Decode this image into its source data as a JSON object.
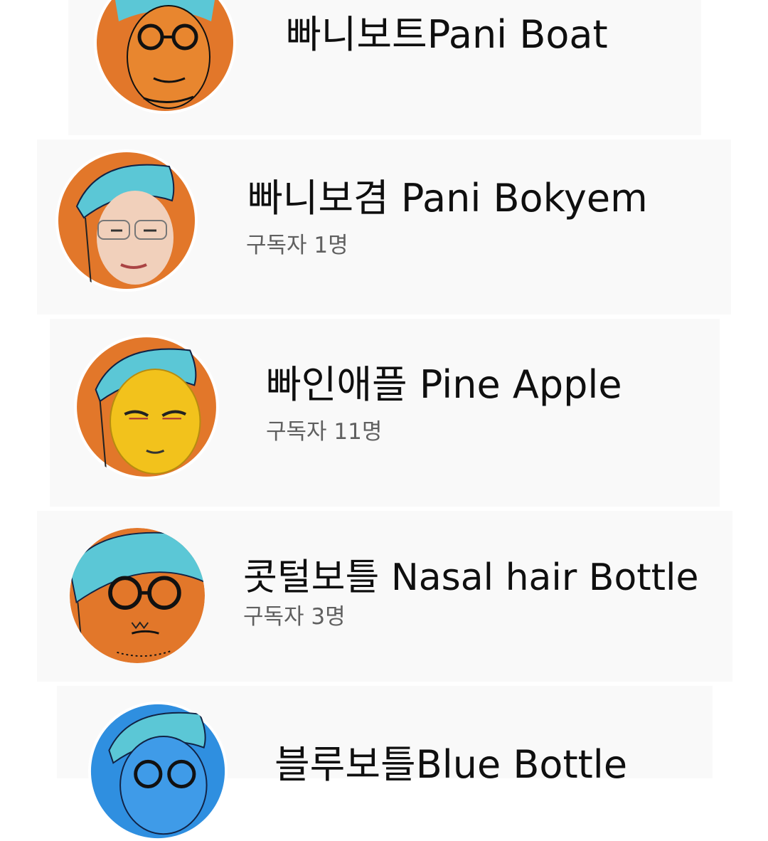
{
  "channels": [
    {
      "name": "빠니보트Pani Boat",
      "subscribers": "",
      "avatar_icon": "cartoon-face-glasses-avatar"
    },
    {
      "name": "빠니보겸 Pani Bokyem",
      "subscribers": "구독자 1명",
      "avatar_icon": "photo-face-avatar"
    },
    {
      "name": "빠인애플 Pine Apple",
      "subscribers": "구독자 11명",
      "avatar_icon": "pineapple-face-avatar"
    },
    {
      "name": "콧털보틀 Nasal hair Bottle",
      "subscribers": "구독자 3명",
      "avatar_icon": "cartoon-face-mustache-avatar"
    },
    {
      "name": "블루보틀Blue Bottle",
      "subscribers": "",
      "avatar_icon": "blue-face-avatar"
    }
  ],
  "colors": {
    "card_background": "#f9f9f9",
    "avatar_orange": "#e2772a",
    "bandana_teal": "#5bc7d6",
    "avatar_blue": "#2f8fe0",
    "pineapple_yellow": "#f2c21c",
    "name_text": "#0f0f0f",
    "subs_text": "#606060"
  }
}
